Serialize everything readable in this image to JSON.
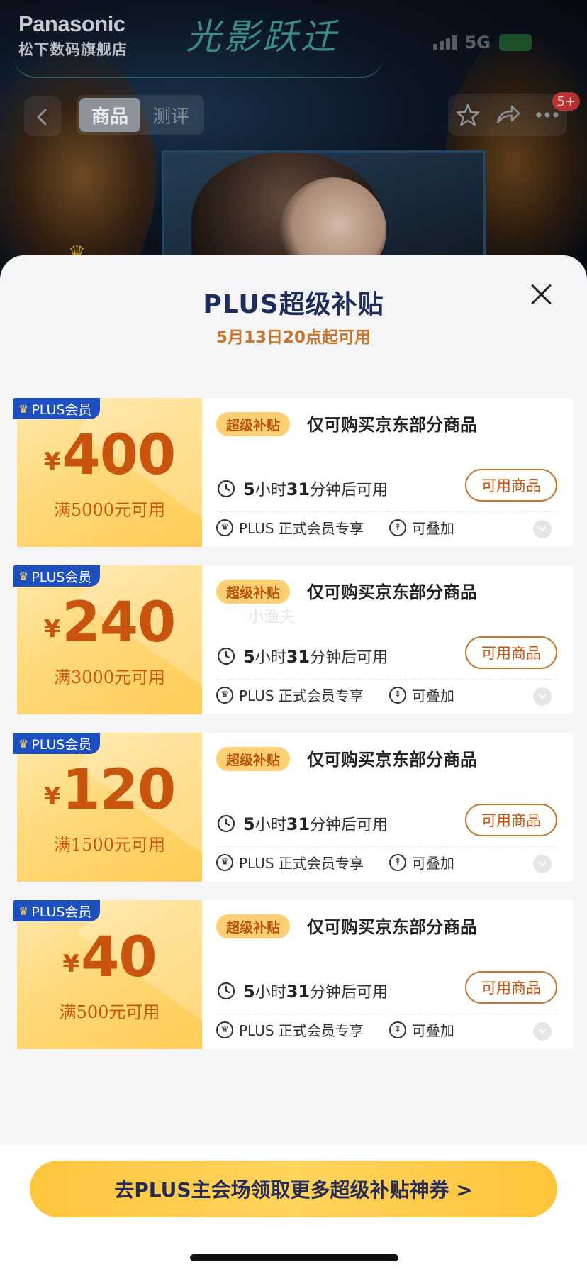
{
  "background": {
    "brand_name": "Panasonic",
    "store_name": "松下数码旗舰店",
    "slogan": "光影跃迁",
    "network": "5G",
    "nav_tabs": [
      {
        "label": "商品",
        "active": true
      },
      {
        "label": "测评",
        "active": false
      }
    ],
    "badge": "5+"
  },
  "sheet": {
    "title": "PLUS超级补贴",
    "subtitle": "5月13日20点起可用"
  },
  "coupons": [
    {
      "tag": "PLUS会员",
      "currency": "¥",
      "amount": "400",
      "condition": "满5000元可用",
      "badge": "超级补贴",
      "desc": "仅可购买京东部分商品",
      "timer": {
        "hours": "5",
        "h_label": "小时",
        "minutes": "31",
        "m_label": "分钟后可用"
      },
      "button": "可用商品",
      "member": "PLUS 正式会员专享",
      "stack": "可叠加"
    },
    {
      "tag": "PLUS会员",
      "currency": "¥",
      "amount": "240",
      "condition": "满3000元可用",
      "badge": "超级补贴",
      "desc": "仅可购买京东部分商品",
      "timer": {
        "hours": "5",
        "h_label": "小时",
        "minutes": "31",
        "m_label": "分钟后可用"
      },
      "button": "可用商品",
      "member": "PLUS 正式会员专享",
      "stack": "可叠加"
    },
    {
      "tag": "PLUS会员",
      "currency": "¥",
      "amount": "120",
      "condition": "满1500元可用",
      "badge": "超级补贴",
      "desc": "仅可购买京东部分商品",
      "timer": {
        "hours": "5",
        "h_label": "小时",
        "minutes": "31",
        "m_label": "分钟后可用"
      },
      "button": "可用商品",
      "member": "PLUS 正式会员专享",
      "stack": "可叠加"
    },
    {
      "tag": "PLUS会员",
      "currency": "¥",
      "amount": "40",
      "condition": "满500元可用",
      "badge": "超级补贴",
      "desc": "仅可购买京东部分商品",
      "timer": {
        "hours": "5",
        "h_label": "小时",
        "minutes": "31",
        "m_label": "分钟后可用"
      },
      "button": "可用商品",
      "member": "PLUS 正式会员专享",
      "stack": "可叠加"
    }
  ],
  "watermark": "小渔夫",
  "cta": "去PLUS主会场领取更多超级补贴神券 >",
  "colors": {
    "title": "#1f2d5c",
    "accent_orange": "#c9540d",
    "plus_blue": "#1e4fbf",
    "cta_yellow": "#ffc53d"
  }
}
